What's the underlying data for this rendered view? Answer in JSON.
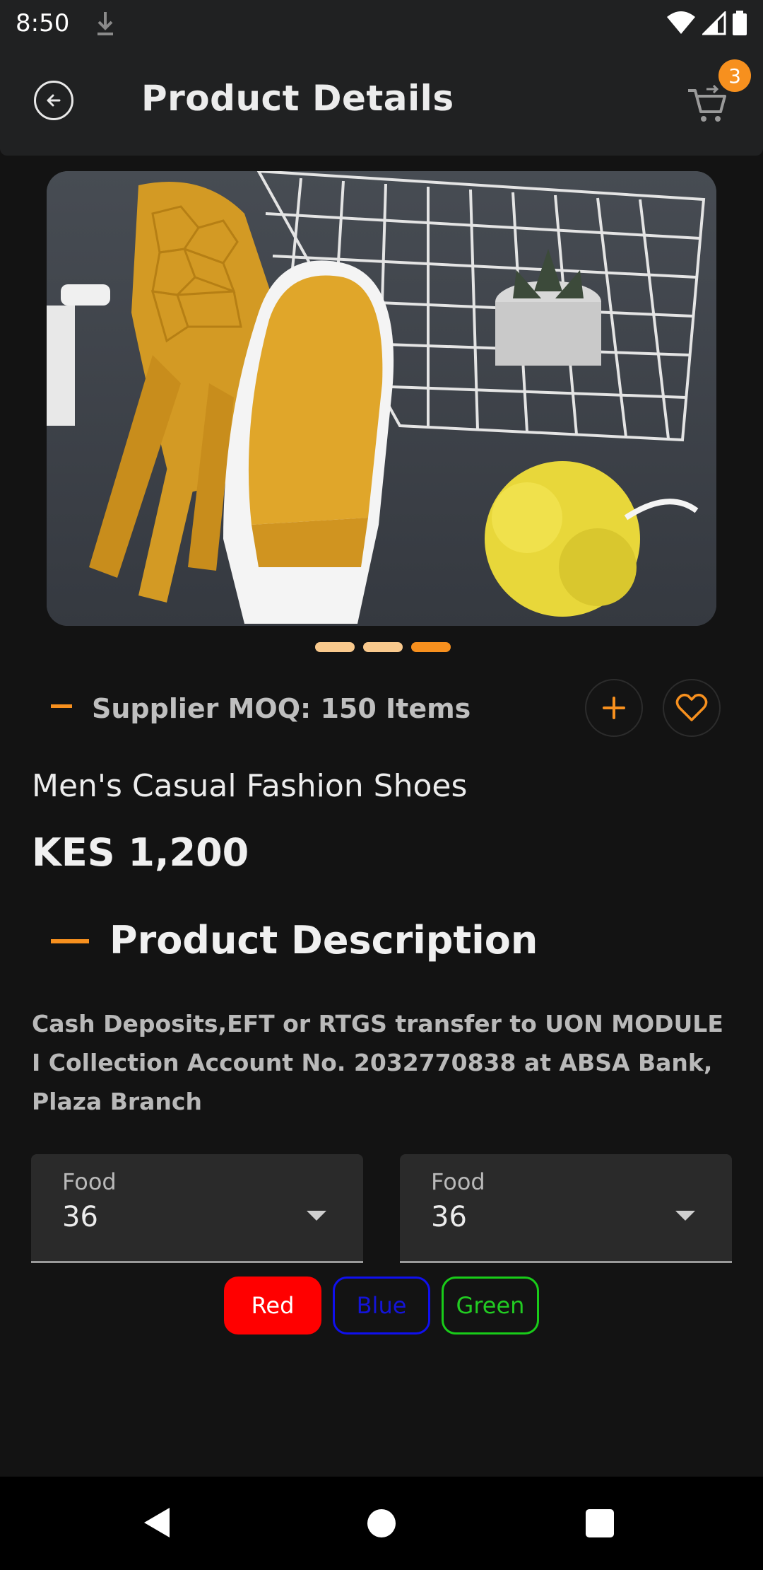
{
  "status_bar": {
    "time": "8:50"
  },
  "header": {
    "title": "Product Details",
    "cart_count": "3"
  },
  "carousel": {
    "slides": 3,
    "active_index": 2
  },
  "moq": {
    "text": "Supplier MOQ: 150 Items"
  },
  "product": {
    "name": "Men's Casual Fashion Shoes",
    "price": "KES 1,200"
  },
  "description": {
    "heading": "Product Description",
    "text": "Cash Deposits,EFT or RTGS transfer to UON MODULE I Collection Account No. 2032770838 at ABSA Bank, Plaza Branch"
  },
  "dropdowns": [
    {
      "label": "Food",
      "value": "36"
    },
    {
      "label": "Food",
      "value": "36"
    }
  ],
  "color_chips": [
    {
      "label": "Red",
      "color": "#ff0000",
      "selected": true
    },
    {
      "label": "Blue",
      "color": "#1010ee",
      "selected": false
    },
    {
      "label": "Green",
      "color": "#19cc19",
      "selected": false
    }
  ],
  "colors": {
    "accent": "#f7901e",
    "background": "#131313",
    "surface": "#202122"
  }
}
